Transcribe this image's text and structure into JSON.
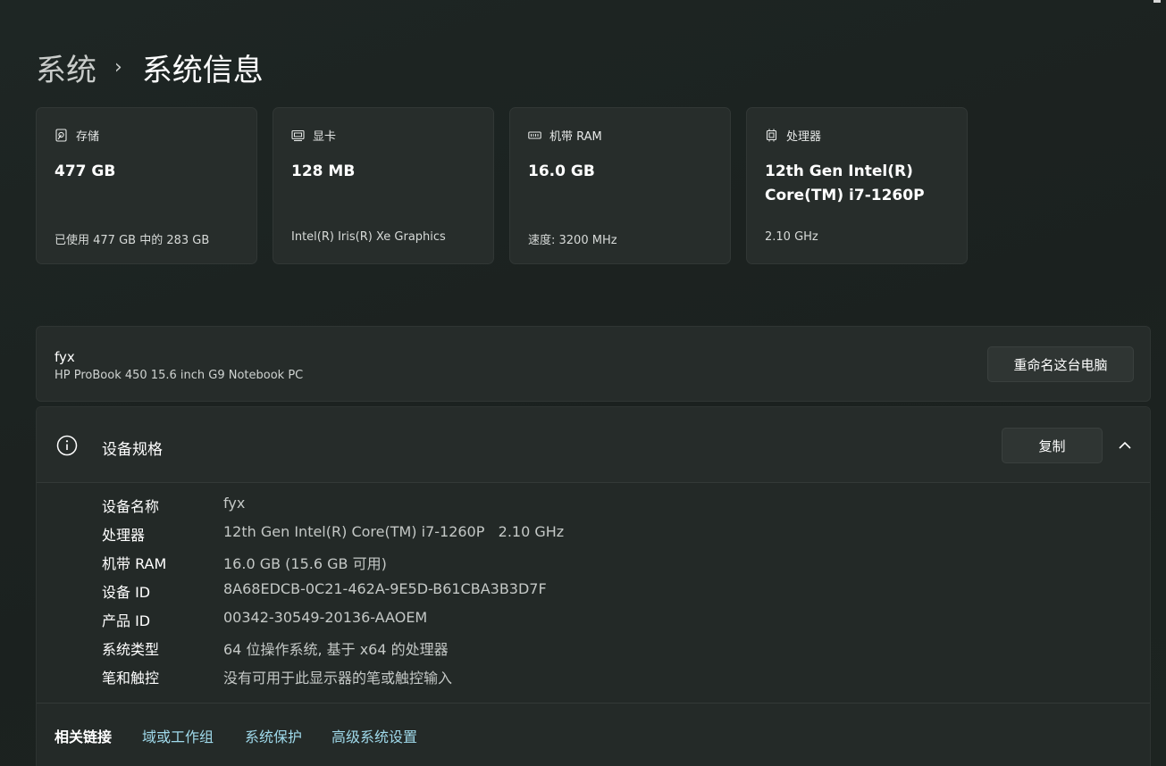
{
  "breadcrumb": {
    "parent": "系统",
    "separator": "›",
    "current": "系统信息"
  },
  "cards": [
    {
      "icon": "storage-icon",
      "title": "存储",
      "value": "477 GB",
      "sub": "已使用 477 GB 中的 283 GB"
    },
    {
      "icon": "display-adapter-icon",
      "title": "显卡",
      "value": "128 MB",
      "sub": "Intel(R) Iris(R) Xe Graphics"
    },
    {
      "icon": "ram-icon",
      "title": "机带 RAM",
      "value": "16.0 GB",
      "sub": "速度: 3200 MHz"
    },
    {
      "icon": "processor-icon",
      "title": "处理器",
      "value": "12th Gen Intel(R) Core(TM) i7-1260P",
      "sub": "2.10 GHz"
    }
  ],
  "device": {
    "name": "fyx",
    "model": "HP ProBook 450 15.6 inch G9 Notebook PC",
    "rename_label": "重命名这台电脑"
  },
  "specs": {
    "title": "设备规格",
    "copy_label": "复制",
    "rows": [
      {
        "label": "设备名称",
        "value": "fyx"
      },
      {
        "label": "处理器",
        "value": "12th Gen Intel(R) Core(TM) i7-1260P   2.10 GHz"
      },
      {
        "label": "机带 RAM",
        "value": "16.0 GB (15.6 GB 可用)"
      },
      {
        "label": "设备 ID",
        "value": "8A68EDCB-0C21-462A-9E5D-B61CBA3B3D7F"
      },
      {
        "label": "产品 ID",
        "value": "00342-30549-20136-AAOEM"
      },
      {
        "label": "系统类型",
        "value": "64 位操作系统, 基于 x64 的处理器"
      },
      {
        "label": "笔和触控",
        "value": "没有可用于此显示器的笔或触控输入"
      }
    ]
  },
  "related": {
    "label": "相关链接",
    "links": [
      "域或工作组",
      "系统保护",
      "高级系统设置"
    ]
  },
  "colors": {
    "background": "#1c2220",
    "card": "#272d2b",
    "link": "#9fd9ea"
  }
}
